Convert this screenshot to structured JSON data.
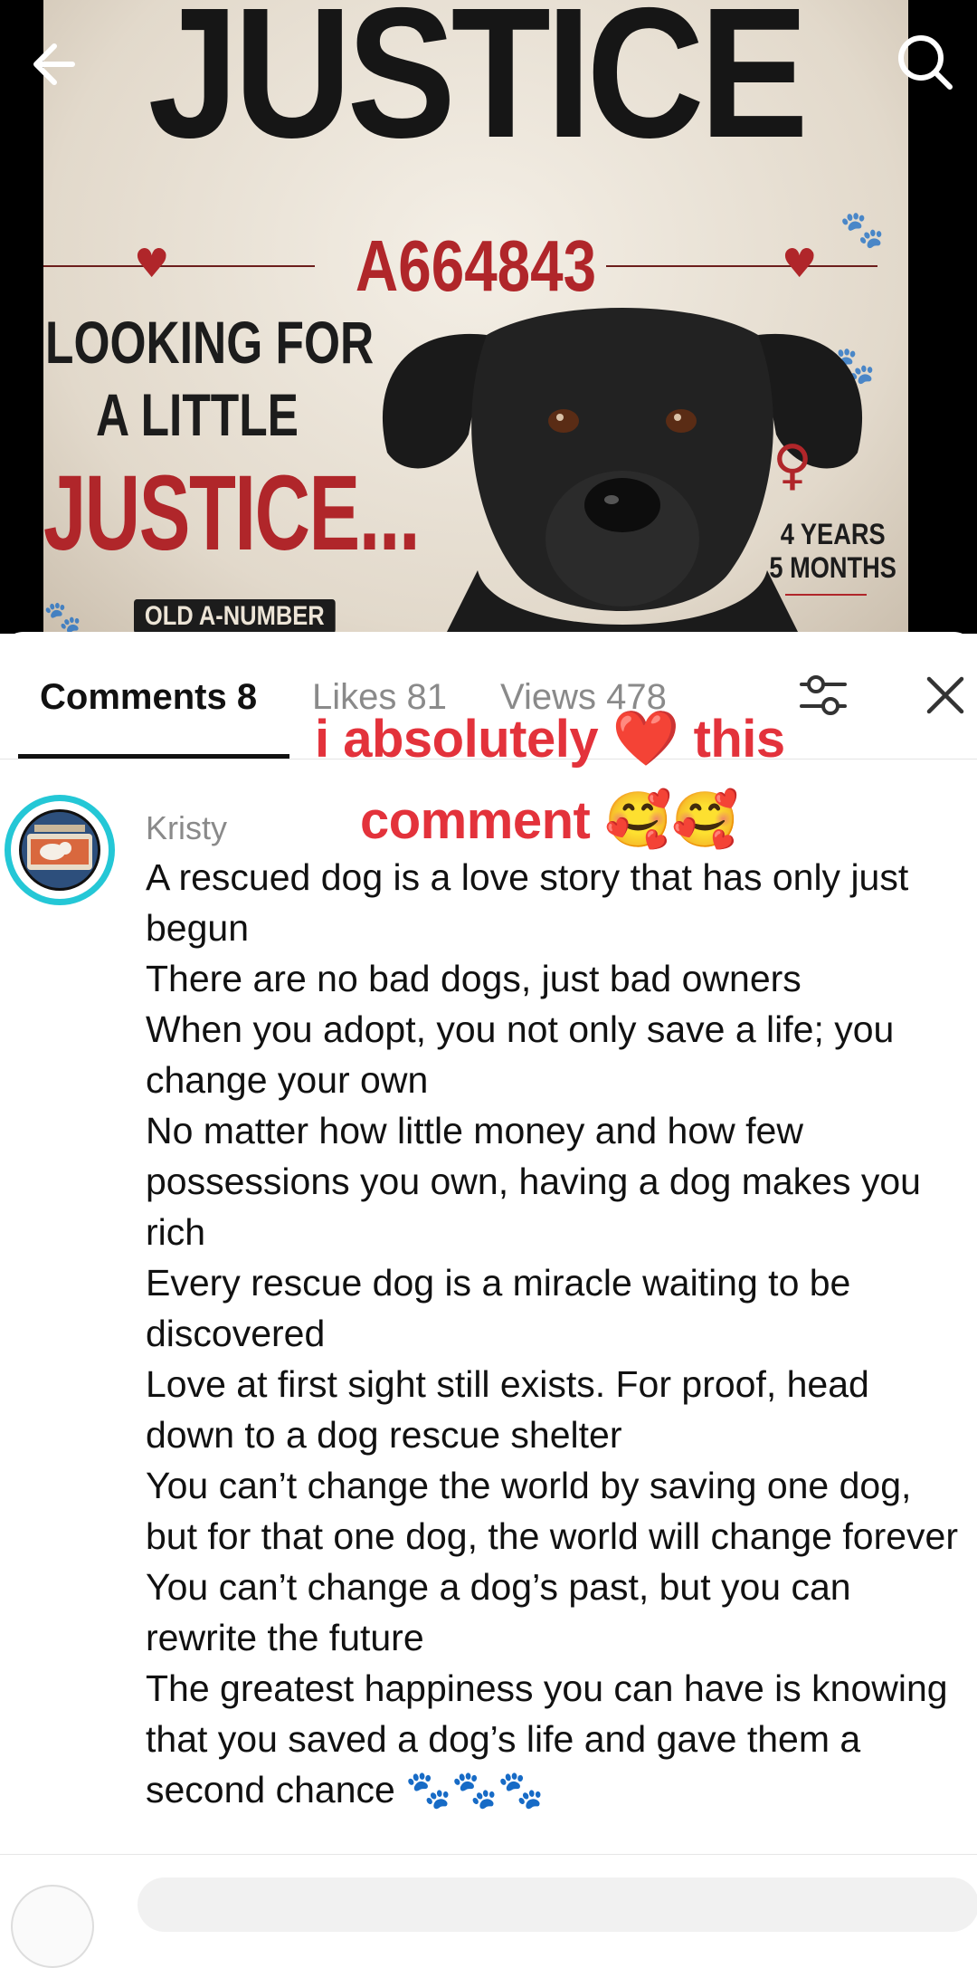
{
  "poster": {
    "title": "JUSTICE",
    "a_number": "A664843",
    "looking_line1": "LOOKING FOR",
    "looking_line2": "A LITTLE",
    "looking_line3": "JUSTICE...",
    "age_line1": "4 YEARS",
    "age_line2": "5 MONTHS",
    "old_tag": "OLD A-NUMBER",
    "accent_color": "#b0262a"
  },
  "nav": {
    "back_icon": "arrow-left-icon",
    "search_icon": "search-icon"
  },
  "tabs": {
    "comments": "Comments 8",
    "likes": "Likes 81",
    "views": "Views 478"
  },
  "sticker": {
    "line1_a": "i absolutely",
    "line1_b": "this",
    "line2": "comment",
    "color": "#e3323b"
  },
  "comment": {
    "username": "Kristy",
    "lines": [
      "A rescued dog is a love story that has only just begun",
      "There are no bad dogs, just bad owners",
      "When you adopt, you not only save a life; you change your own",
      "No matter how little money and how few possessions you own, having a dog makes you rich",
      "Every rescue dog is a miracle waiting to be discovered",
      "Love at first sight still exists. For proof, head down to a dog rescue shelter",
      "You can’t change the world by saving one dog, but for that one dog, the world will change forever",
      "You can’t change a dog’s past, but you can rewrite the future",
      "The greatest happiness you can have is knowing that you saved a dog’s life and gave them a second chance 🐾🐾🐾"
    ]
  }
}
